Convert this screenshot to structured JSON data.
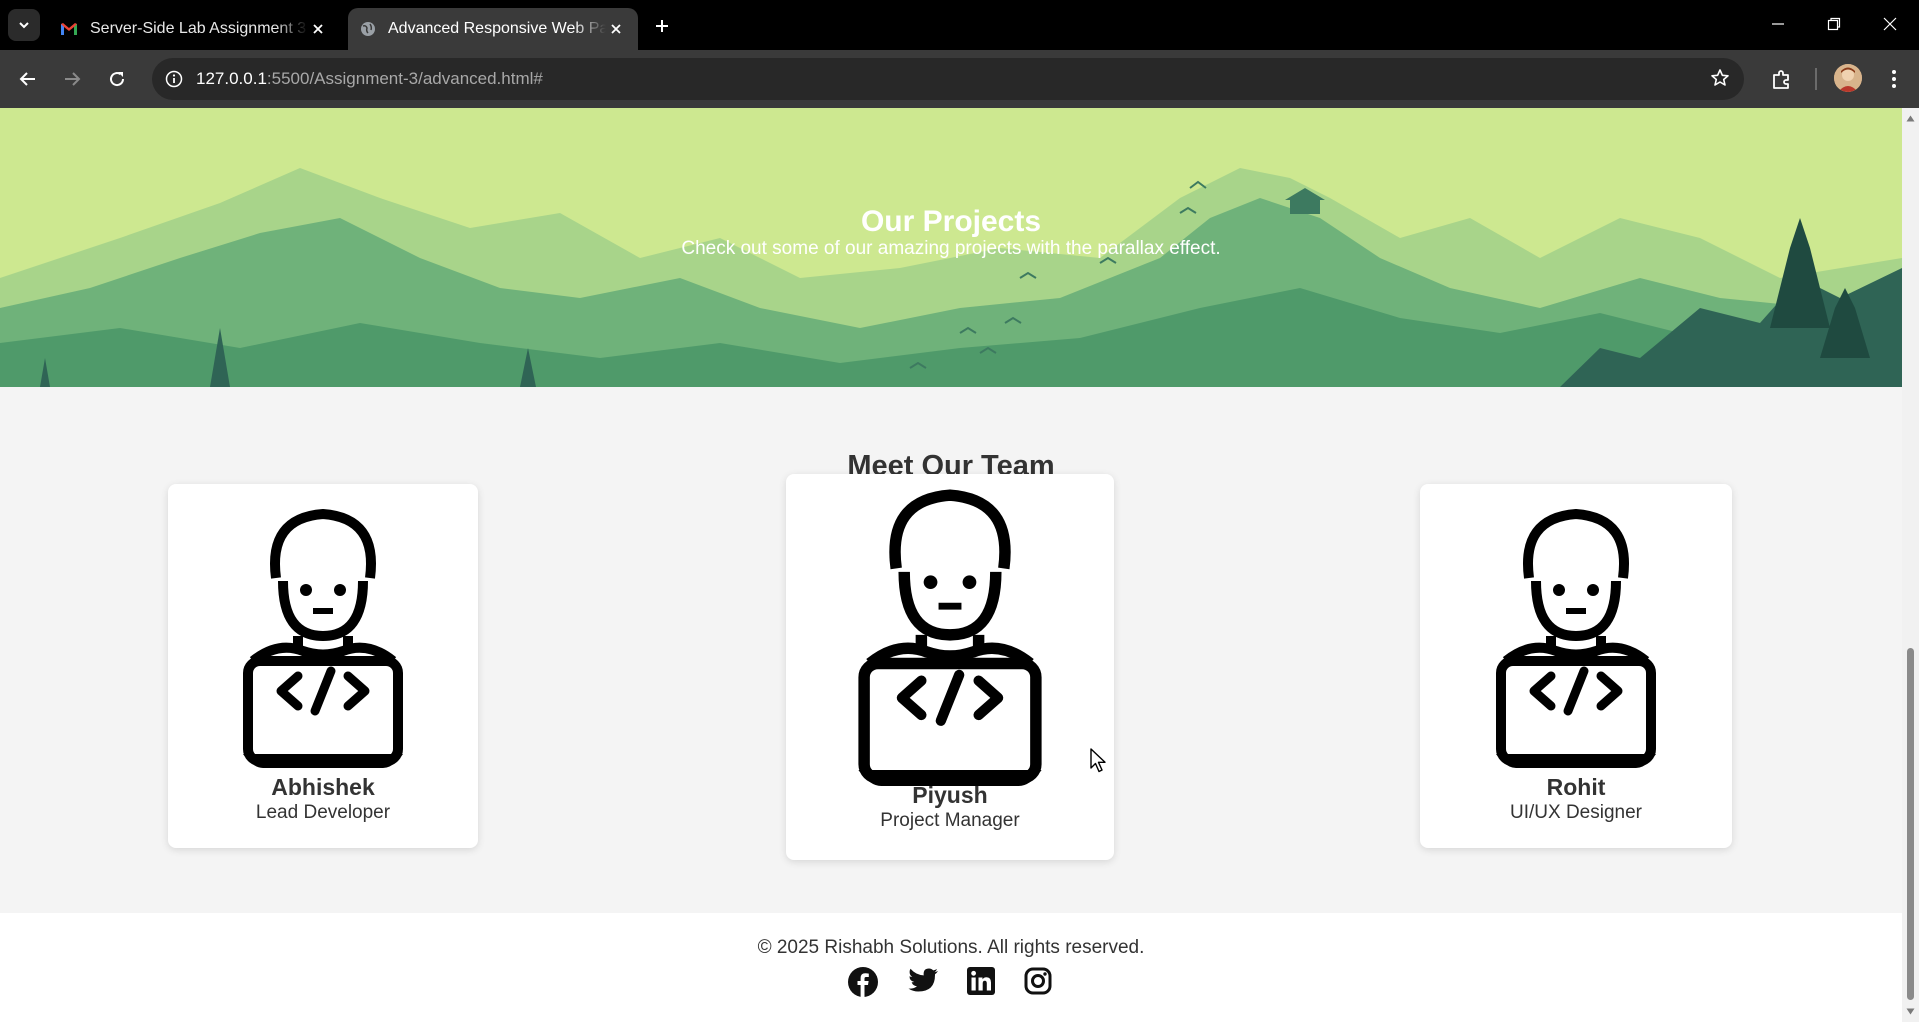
{
  "browser": {
    "tabs": [
      {
        "title": "Server-Side Lab Assignment 3 -",
        "icon": "gmail-icon",
        "active": false
      },
      {
        "title": "Advanced Responsive Web Page",
        "icon": "globe-icon",
        "active": true
      }
    ],
    "url_host": "127.0.0.1",
    "url_rest": ":5500/Assignment-3/advanced.html#"
  },
  "hero": {
    "title": "Our Projects",
    "subtitle": "Check out some of our amazing projects with the parallax effect."
  },
  "team": {
    "title": "Meet Our Team",
    "members": [
      {
        "name": "Abhishek",
        "role": "Lead Developer",
        "icon": "developer-avatar-icon"
      },
      {
        "name": "Piyush",
        "role": "Project Manager",
        "icon": "developer-avatar-icon"
      },
      {
        "name": "Rohit",
        "role": "UI/UX Designer",
        "icon": "developer-avatar-icon"
      }
    ]
  },
  "footer": {
    "copyright": "© 2025 Rishabh Solutions. All rights reserved.",
    "social": [
      "facebook-icon",
      "twitter-icon",
      "linkedin-icon",
      "instagram-icon"
    ]
  },
  "colors": {
    "hero_sky": "#cde890",
    "hero_mountain": "#4f9a6a",
    "page_bg": "#f4f4f4",
    "chrome_dark": "#3a3a3a"
  }
}
